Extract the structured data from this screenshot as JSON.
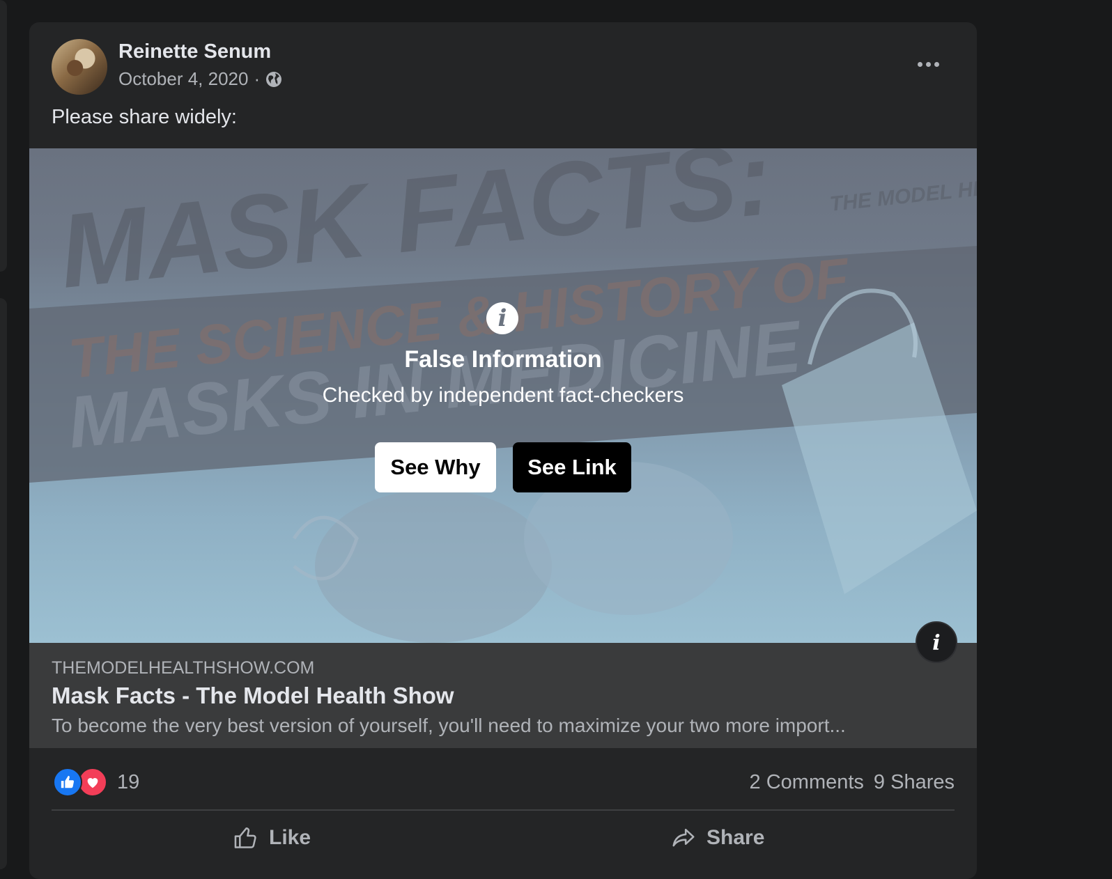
{
  "post": {
    "author": "Reinette Senum",
    "date": "October 4, 2020",
    "separator": "·",
    "privacy_icon": "globe-icon",
    "text": "Please share widely:"
  },
  "overlay": {
    "title": "False Information",
    "subtitle": "Checked by independent fact-checkers",
    "see_why_label": "See Why",
    "see_link_label": "See Link",
    "info_glyph": "i"
  },
  "link_preview": {
    "domain": "THEMODELHEALTHSHOW.COM",
    "title": "Mask Facts - The Model Health Show",
    "description": "To become the very best version of yourself, you'll need to maximize your two more import..."
  },
  "image_text": {
    "headline": "MASK FACTS:",
    "line2": "THE SCIENCE & HISTORY OF",
    "line3": "MASKS IN MEDICINE",
    "brand": "THE MODEL HEALTH SHOW"
  },
  "engagement": {
    "reaction_count": "19",
    "comments": "2 Comments",
    "shares": "9 Shares"
  },
  "actions": {
    "like_label": "Like",
    "share_label": "Share"
  },
  "colors": {
    "background": "#18191a",
    "card": "#242526",
    "link_card": "#3a3b3c",
    "like_blue": "#1877f2",
    "love_red": "#f33e58"
  }
}
